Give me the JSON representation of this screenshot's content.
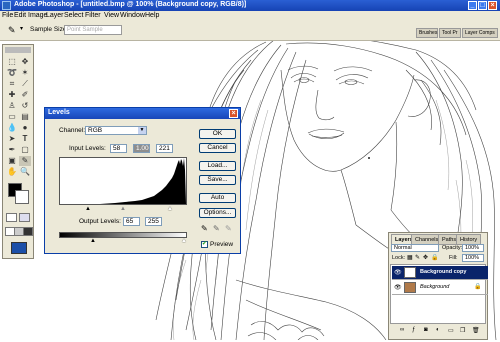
{
  "window": {
    "title": "Adobe Photoshop - [untitled.bmp @ 100% (Background copy, RGB/8)]"
  },
  "menu": [
    "File",
    "Edit",
    "Image",
    "Layer",
    "Select",
    "Filter",
    "View",
    "Window",
    "Help"
  ],
  "options_bar": {
    "sample_size_label": "Sample Size:",
    "sample_size_value": "Point Sample"
  },
  "palette_tabs": [
    "Brushes",
    "Tool Pr",
    "Layer Comps"
  ],
  "levels": {
    "title": "Levels",
    "channel_label": "Channel:",
    "channel_value": "RGB",
    "input_levels_label": "Input Levels:",
    "input_black": "58",
    "input_gamma": "1.00",
    "input_white": "221",
    "output_levels_label": "Output Levels:",
    "output_black": "65",
    "output_white": "255",
    "preview_label": "Preview",
    "preview_checked": true,
    "buttons": {
      "ok": "OK",
      "cancel": "Cancel",
      "load": "Load...",
      "save": "Save...",
      "auto": "Auto",
      "options": "Options..."
    }
  },
  "layers": {
    "tabs": [
      "Layers",
      "Channels",
      "Paths",
      "History"
    ],
    "blend_mode": "Normal",
    "opacity_label": "Opacity:",
    "opacity": "100%",
    "lock_label": "Lock:",
    "fill_label": "Fill:",
    "fill": "100%",
    "items": [
      {
        "name": "Background copy",
        "selected": true
      },
      {
        "name": "Background",
        "selected": false
      }
    ]
  }
}
